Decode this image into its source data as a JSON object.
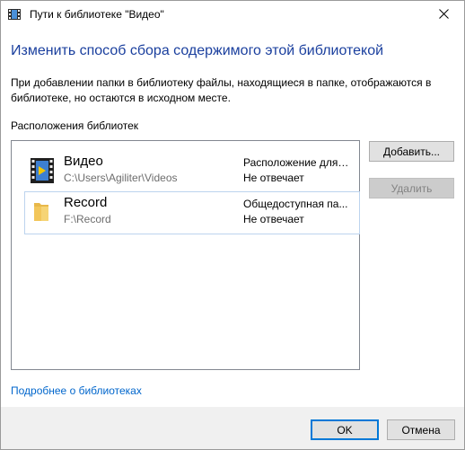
{
  "window": {
    "title": "Пути к библиотеке \"Видео\"",
    "icon": "video-library-icon",
    "close_icon": "close-icon"
  },
  "main": {
    "heading": "Изменить способ сбора содержимого этой библиотекой",
    "description": "При добавлении папки в библиотеку файлы, находящиеся в папке, отображаются в библиотеке, но остаются в исходном месте.",
    "section_label": "Расположения библиотек"
  },
  "locations": [
    {
      "name": "Видео",
      "path": "C:\\Users\\Agiliter\\Videos",
      "type": "Расположение для ...",
      "status": "Не отвечает",
      "icon": "video-folder-icon",
      "selected": false
    },
    {
      "name": "Record",
      "path": "F:\\Record",
      "type": "Общедоступная па...",
      "status": "Не отвечает",
      "icon": "folder-icon",
      "selected": true
    }
  ],
  "buttons": {
    "add": "Добавить...",
    "remove": "Удалить",
    "ok": "OK",
    "cancel": "Отмена"
  },
  "link": "Подробнее о библиотеках",
  "colors": {
    "heading": "#1a3f9e",
    "link": "#0066cc",
    "accent": "#0078d7",
    "footer_bg": "#f0f0f0"
  }
}
